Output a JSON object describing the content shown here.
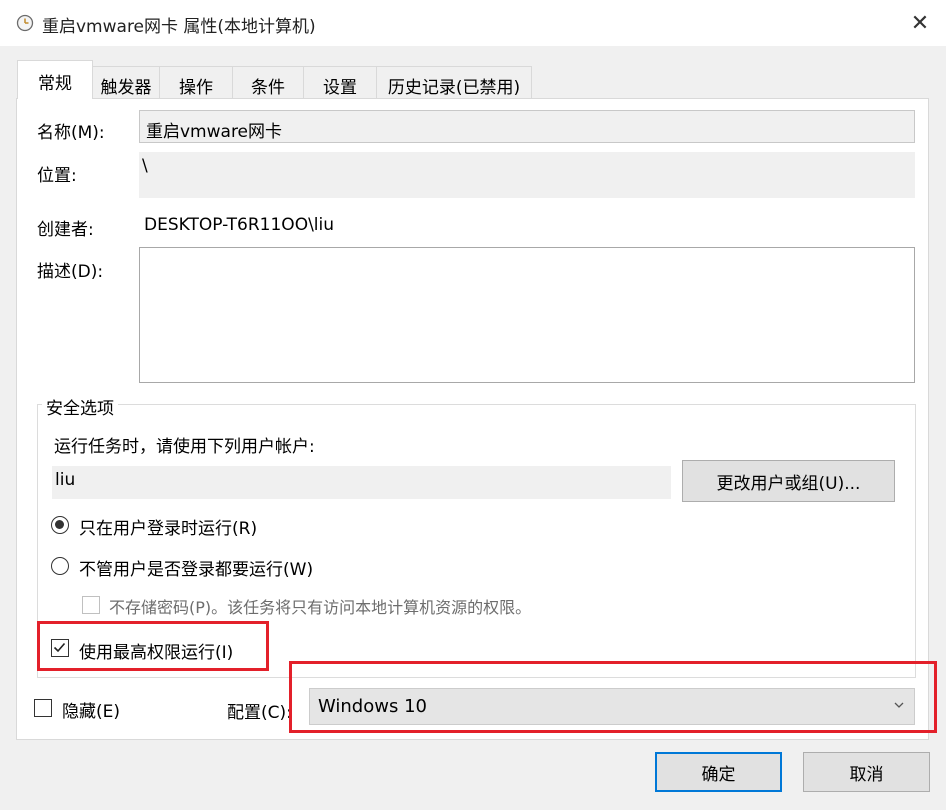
{
  "window": {
    "title": "重启vmware网卡 属性(本地计算机)",
    "icon": "clock-icon",
    "close_glyph": "✕"
  },
  "tabs": [
    {
      "label": "常规",
      "active": true
    },
    {
      "label": "触发器",
      "active": false
    },
    {
      "label": "操作",
      "active": false
    },
    {
      "label": "条件",
      "active": false
    },
    {
      "label": "设置",
      "active": false
    },
    {
      "label": "历史记录(已禁用)",
      "active": false
    }
  ],
  "general": {
    "name_label": "名称(M):",
    "name_value": "重启vmware网卡",
    "location_label": "位置:",
    "location_value": "\\",
    "author_label": "创建者:",
    "author_value": "DESKTOP-T6R11OO\\liu",
    "description_label": "描述(D):",
    "description_value": ""
  },
  "security": {
    "group_title": "安全选项",
    "run_as_prompt": "运行任务时，请使用下列用户帐户:",
    "user_account": "liu",
    "change_user_button": "更改用户或组(U)...",
    "radio_logged_on_only": {
      "label": "只在用户登录时运行(R)",
      "checked": true
    },
    "radio_logged_on_or_not": {
      "label": "不管用户是否登录都要运行(W)",
      "checked": false
    },
    "do_not_store_password": {
      "label": "不存储密码(P)。该任务将只有访问本地计算机资源的权限。",
      "checked": false,
      "enabled": false
    },
    "run_highest_privileges": {
      "label": "使用最高权限运行(I)",
      "checked": true
    }
  },
  "bottom": {
    "hidden_label": "隐藏(E)",
    "hidden_checked": false,
    "configure_label": "配置(C):",
    "configure_value": "Windows 10"
  },
  "buttons": {
    "ok": "确定",
    "cancel": "取消"
  },
  "colors": {
    "highlight_red": "#e3202a",
    "ok_border": "#0078d7"
  }
}
